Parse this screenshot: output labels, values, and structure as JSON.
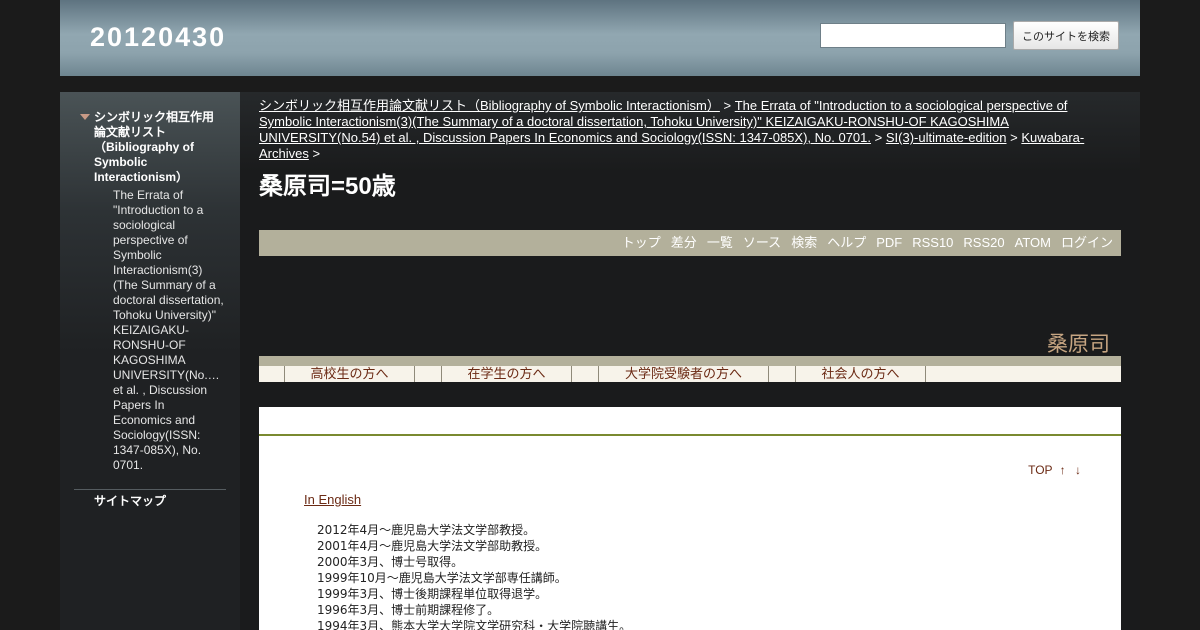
{
  "header": {
    "site_title": "20120430",
    "search_placeholder": "",
    "search_button": "このサイトを検索"
  },
  "sidebar": {
    "root_item": "シンボリック相互作用論文献リスト（Bibliography of Symbolic Interactionism）",
    "child_item": "The Errata of \"Introduction to a sociological perspective of Symbolic Interactionism(3)(The Summary of a doctoral dissertation, Tohoku University)\" KEIZAIGAKU-RONSHU-OF KAGOSHIMA UNIVERSITY(No.… et al. , Discussion Papers In Economics and Sociology(ISSN: 1347-085X), No. 0701.",
    "sitemap": "サイトマップ"
  },
  "breadcrumb": {
    "items": [
      "シンボリック相互作用論文献リスト（Bibliography of Symbolic Interactionism）",
      "The Errata of \"Introduction to a sociological perspective of Symbolic Interactionism(3)(The Summary of a doctoral dissertation, Tohoku University)\" KEIZAIGAKU-RONSHU-OF KAGOSHIMA UNIVERSITY(No.54) et al. , Discussion Papers In Economics and Sociology(ISSN: 1347-085X), No. 0701.",
      "SI(3)-ultimate-edition",
      "Kuwabara-Archives"
    ],
    "separator": ">"
  },
  "page_title": "桑原司=50歳",
  "toolbar": [
    "トップ",
    "差分",
    "一覧",
    "ソース",
    "検索",
    "ヘルプ",
    "PDF",
    "RSS10",
    "RSS20",
    "ATOM",
    "ログイン"
  ],
  "name_heading": "桑原司",
  "tabs": [
    "高校生の方へ",
    "在学生の方へ",
    "大学院受験者の方へ",
    "社会人の方へ"
  ],
  "content": {
    "top_label": "TOP",
    "up_arrow": "↑",
    "down_arrow": "↓",
    "english_link": "In English",
    "career": [
      "2012年4月～鹿児島大学法文学部教授。",
      "2001年4月～鹿児島大学法文学部助教授。",
      "2000年3月、博士号取得。",
      "1999年10月～鹿児島大学法文学部専任講師。",
      "1999年3月、博士後期課程単位取得退学。",
      "1996年3月、博士前期課程修了。",
      "1994年3月、熊本大学大学院文学研究科・大学院聴講生。"
    ]
  }
}
